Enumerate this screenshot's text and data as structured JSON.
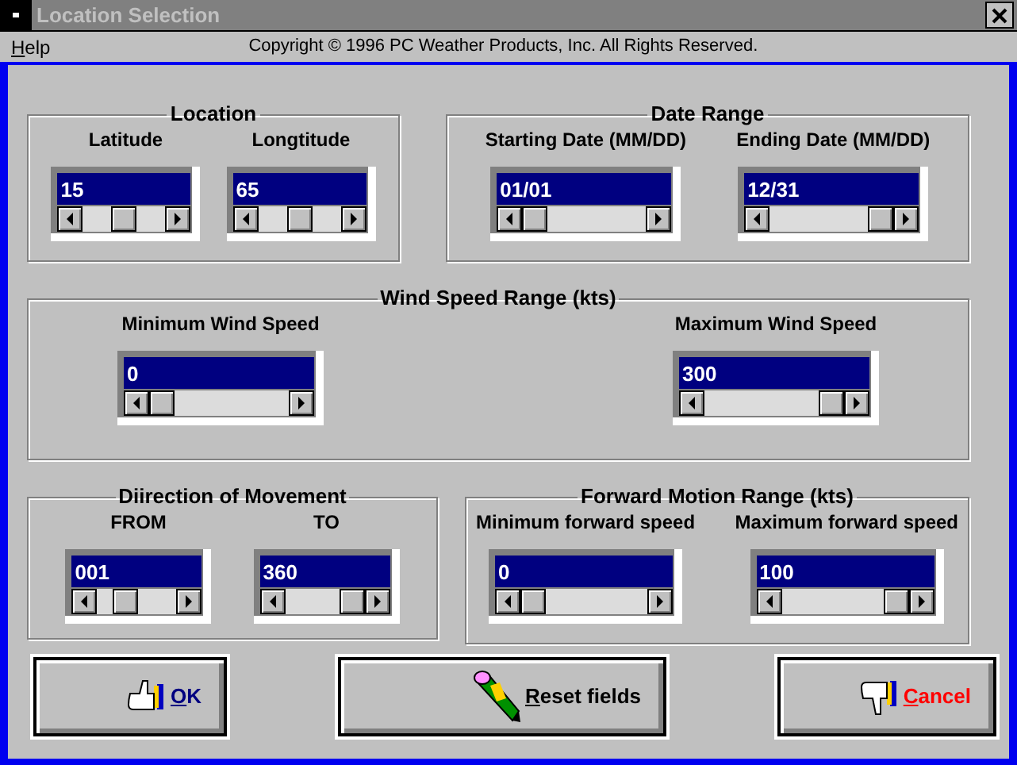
{
  "window": {
    "title": "Location Selection"
  },
  "menu": [
    {
      "label": "Help",
      "underline_first": true
    }
  ],
  "copyright": "Copyright © 1996 PC Weather Products, Inc. All Rights Reserved.",
  "groups": [
    {
      "title": "Location",
      "fields": [
        {
          "label": "Latitude",
          "value": "15",
          "level": 0.5
        },
        {
          "label": "Longtitude",
          "value": "65",
          "level": 0.5
        }
      ]
    },
    {
      "title": "Date Range",
      "fields": [
        {
          "label": "Starting Date (MM/DD)",
          "value": "01/01",
          "level": 0
        },
        {
          "label": "Ending Date (MM/DD)",
          "value": "12/31",
          "level": 1
        }
      ]
    },
    {
      "title": "Wind Speed Range (kts)",
      "fields": [
        {
          "label": "Minimum Wind Speed",
          "value": "0",
          "level": 0
        },
        {
          "label": "Maximum Wind Speed",
          "value": "300",
          "level": 1
        }
      ]
    },
    {
      "title": "Diirection of Movement",
      "fields": [
        {
          "label": "FROM",
          "value": "001",
          "level": 0.3
        },
        {
          "label": "TO",
          "value": "360",
          "level": 1
        }
      ]
    },
    {
      "title": "Forward Motion Range (kts)",
      "fields": [
        {
          "label": "Minimum forward speed",
          "value": "0",
          "level": 0
        },
        {
          "label": "Maximum forward speed",
          "value": "100",
          "level": 1
        }
      ]
    }
  ],
  "buttons": [
    {
      "kind": "ok",
      "label": "OK",
      "underline_first": true
    },
    {
      "kind": "reset",
      "label": "Reset fields",
      "underline_first": true
    },
    {
      "kind": "cancel",
      "label": "Cancel",
      "underline_first": true
    }
  ]
}
